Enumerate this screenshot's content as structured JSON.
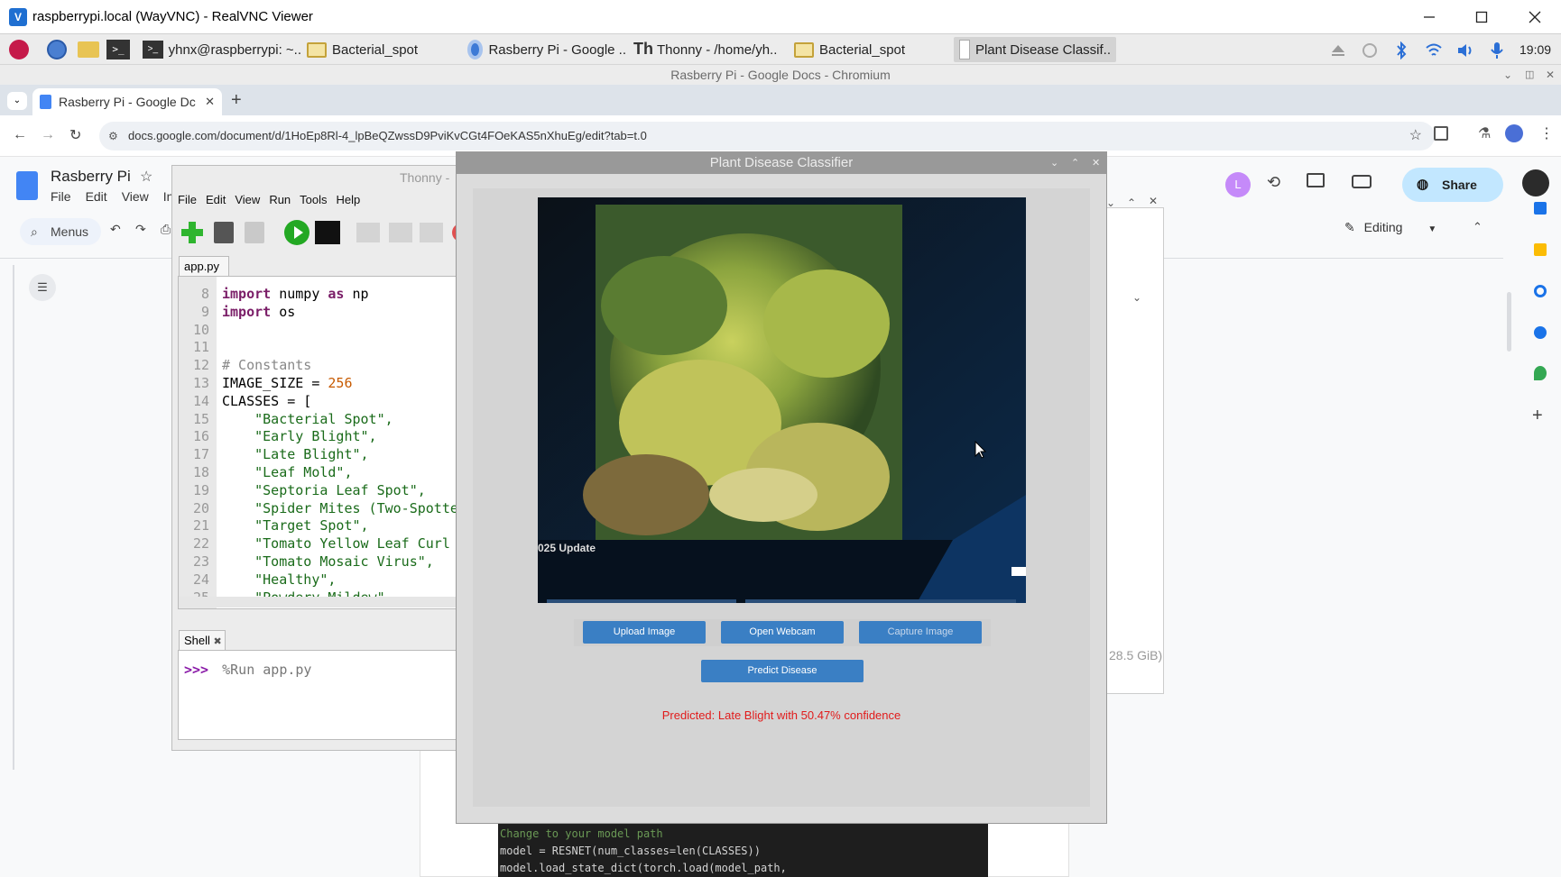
{
  "vnc": {
    "title": "raspberrypi.local (WayVNC) - RealVNC Viewer"
  },
  "taskbar": {
    "items": [
      {
        "label": "yhnx@raspberrypi: ~.."
      },
      {
        "label": "Bacterial_spot"
      },
      {
        "label": "Rasberry Pi - Google .."
      },
      {
        "label": "Thonny  -  /home/yh.."
      },
      {
        "label": "Bacterial_spot"
      },
      {
        "label": "Plant Disease Classif.."
      }
    ],
    "clock": "19:09"
  },
  "chromium": {
    "window_title": "Rasberry Pi - Google Docs - Chromium",
    "tab_label": "Rasberry Pi - Google Dc",
    "url": "docs.google.com/document/d/1HoEp8Rl-4_lpBeQZwssD9PviKvCGt4FOeKAS5nXhuEg/edit?tab=t.0"
  },
  "docs": {
    "title": "Rasberry Pi",
    "menus": [
      "File",
      "Edit",
      "View",
      "Ins"
    ],
    "menus_search": "Menus",
    "share": "Share",
    "editing": "Editing",
    "avatar_letter": "L",
    "storage_text": "28.5 GiB)",
    "doc_code": [
      "Change to your model path",
      "model = RESNET(num_classes=len(CLASSES))",
      "model.load_state_dict(torch.load(model_path,"
    ]
  },
  "thonny": {
    "title": "Thonny  -",
    "menus": [
      "File",
      "Edit",
      "View",
      "Run",
      "Tools",
      "Help"
    ],
    "editor_tab": "app.py",
    "shell_tab": "Shell",
    "shell_prompt": ">>>",
    "shell_cmd": "%Run app.py",
    "lines": [
      {
        "n": "8",
        "segments": [
          {
            "t": "import",
            "c": "#7a1d67",
            "b": true
          },
          {
            "t": " numpy ",
            "c": "#000"
          },
          {
            "t": "as",
            "c": "#7a1d67",
            "b": true
          },
          {
            "t": " np",
            "c": "#000"
          }
        ]
      },
      {
        "n": "9",
        "segments": [
          {
            "t": "import",
            "c": "#7a1d67",
            "b": true
          },
          {
            "t": " os",
            "c": "#000"
          }
        ]
      },
      {
        "n": "10",
        "segments": []
      },
      {
        "n": "11",
        "segments": []
      },
      {
        "n": "12",
        "segments": [
          {
            "t": "# Constants",
            "c": "#888"
          }
        ]
      },
      {
        "n": "13",
        "segments": [
          {
            "t": "IMAGE_SIZE = ",
            "c": "#000"
          },
          {
            "t": "256",
            "c": "#c75a00"
          }
        ]
      },
      {
        "n": "14",
        "segments": [
          {
            "t": "CLASSES = [",
            "c": "#000"
          }
        ]
      },
      {
        "n": "15",
        "segments": [
          {
            "t": "    \"Bacterial Spot\",",
            "c": "#1a6b1a"
          }
        ]
      },
      {
        "n": "16",
        "segments": [
          {
            "t": "    \"Early Blight\",",
            "c": "#1a6b1a"
          }
        ]
      },
      {
        "n": "17",
        "segments": [
          {
            "t": "    \"Late Blight\",",
            "c": "#1a6b1a"
          }
        ]
      },
      {
        "n": "18",
        "segments": [
          {
            "t": "    \"Leaf Mold\",",
            "c": "#1a6b1a"
          }
        ]
      },
      {
        "n": "19",
        "segments": [
          {
            "t": "    \"Septoria Leaf Spot\",",
            "c": "#1a6b1a"
          }
        ]
      },
      {
        "n": "20",
        "segments": [
          {
            "t": "    \"Spider Mites (Two-Spotte",
            "c": "#1a6b1a"
          }
        ]
      },
      {
        "n": "21",
        "segments": [
          {
            "t": "    \"Target Spot\",",
            "c": "#1a6b1a"
          }
        ]
      },
      {
        "n": "22",
        "segments": [
          {
            "t": "    \"Tomato Yellow Leaf Curl",
            "c": "#1a6b1a"
          }
        ]
      },
      {
        "n": "23",
        "segments": [
          {
            "t": "    \"Tomato Mosaic Virus\",",
            "c": "#1a6b1a"
          }
        ]
      },
      {
        "n": "24",
        "segments": [
          {
            "t": "    \"Healthy\",",
            "c": "#1a6b1a"
          }
        ]
      },
      {
        "n": "25",
        "segments": [
          {
            "t": "    \"Powdery Mildew\",",
            "c": "#1a6b1a"
          }
        ]
      }
    ]
  },
  "classifier": {
    "title": "Plant Disease Classifier",
    "image_overlay_text": "025 Update",
    "buttons": {
      "upload": "Upload Image",
      "webcam": "Open Webcam",
      "capture": "Capture Image",
      "predict": "Predict Disease"
    },
    "result": "Predicted: Late Blight with 50.47% confidence",
    "result_color": "#e11b1b"
  },
  "colors": {
    "accent": "#3a7fc4",
    "share_bg": "#c2e7ff"
  }
}
